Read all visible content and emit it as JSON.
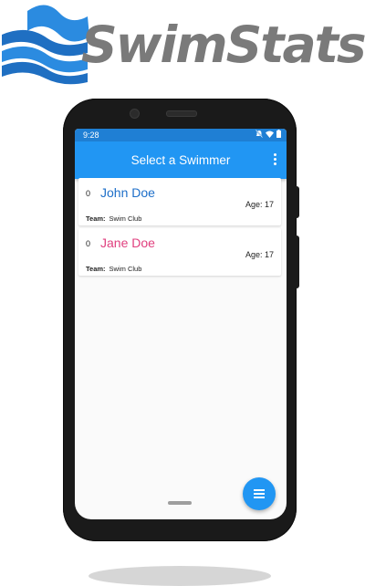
{
  "logo": {
    "text": "SwimStats"
  },
  "status_bar": {
    "time": "9:28"
  },
  "app_bar": {
    "title": "Select a Swimmer"
  },
  "colors": {
    "primary": "#2196f3",
    "status_bar": "#1f7fd4",
    "male_name": "#1e6fc9",
    "female_name": "#e0407f"
  },
  "swimmers": [
    {
      "count": "0",
      "name": "John Doe",
      "age": "Age: 17",
      "team_label": "Team:",
      "team": "Swim Club",
      "name_color": "#1e6fc9"
    },
    {
      "count": "0",
      "name": "Jane Doe",
      "age": "Age: 17",
      "team_label": "Team:",
      "team": "Swim Club",
      "name_color": "#e0407f"
    }
  ],
  "icons": {
    "menu": "more-vert-icon",
    "fab": "list-icon"
  }
}
